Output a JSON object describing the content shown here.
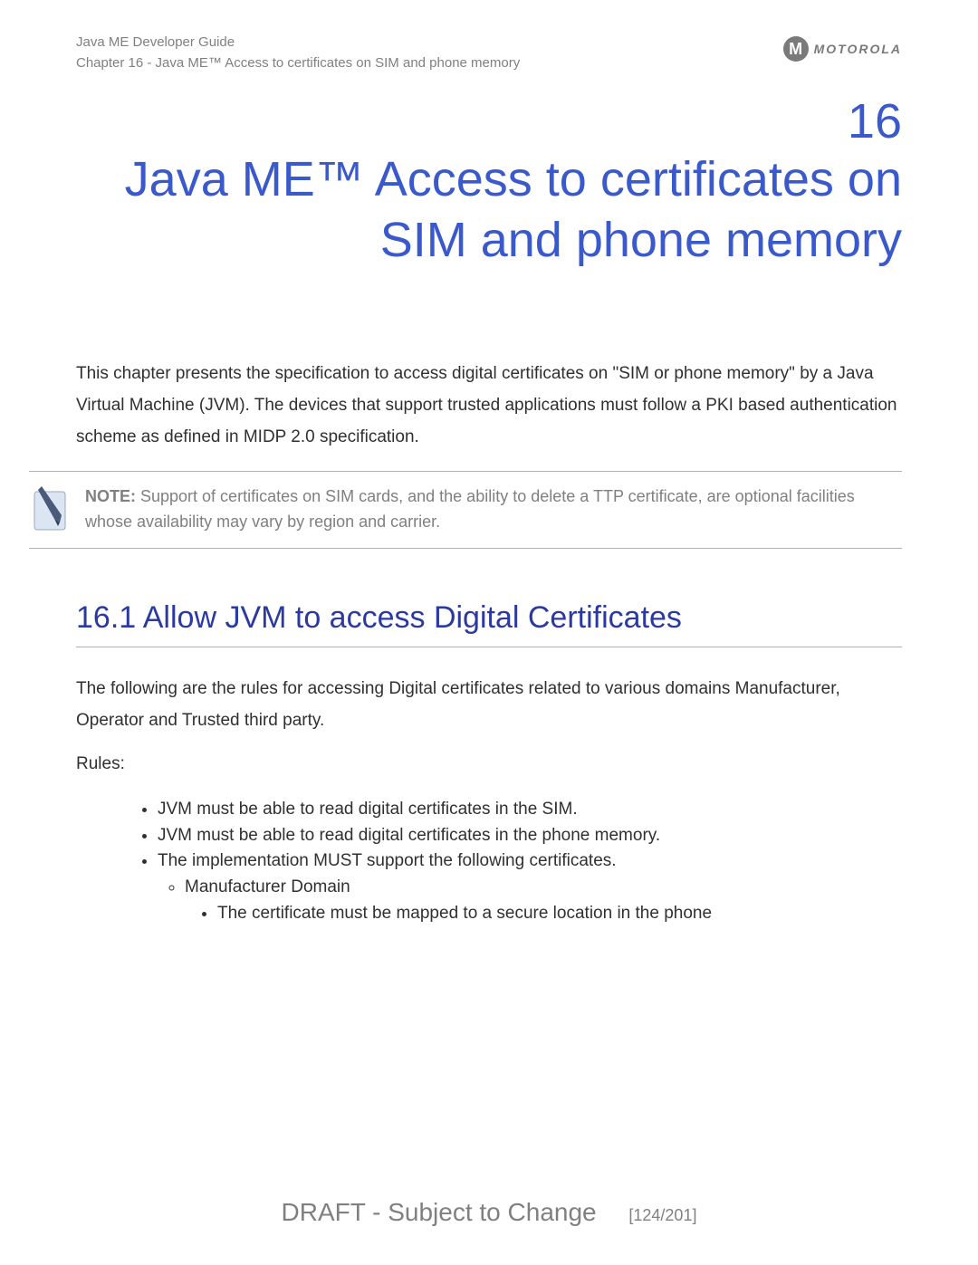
{
  "header": {
    "guide": "Java ME Developer Guide",
    "chapter_line": "Chapter 16 - Java ME™ Access to certificates on SIM and phone memory",
    "brand": "MOTOROLA",
    "brand_glyph": "M"
  },
  "chapter": {
    "number": "16",
    "title": "Java ME™ Access to certificates on SIM and phone memory"
  },
  "intro": "This chapter presents the specification to access digital certificates on \"SIM or phone memory\" by a Java Virtual Machine (JVM). The devices that support trusted applications must follow a PKI based authentication scheme as defined in MIDP 2.0 specification.",
  "note": {
    "label": "NOTE:",
    "text": " Support of certificates on SIM cards, and the ability to delete a TTP certificate, are optional facilities whose availability may vary by region and carrier."
  },
  "section": {
    "heading": "16.1 Allow JVM to access Digital Certificates",
    "lead": "The following are the rules for accessing Digital certificates related to various domains Manufacturer, Operator and Trusted third party.",
    "rules_label": "Rules:",
    "rules": [
      "JVM must be able to read digital certificates in the SIM.",
      "JVM must be able to read digital certificates in the phone memory.",
      "The implementation MUST support the following certificates."
    ],
    "sub": [
      "Manufacturer Domain"
    ],
    "subsub": [
      "The certificate must be mapped to a secure location in the phone"
    ]
  },
  "footer": {
    "status": "DRAFT - Subject to Change",
    "page": "[124/201]"
  }
}
